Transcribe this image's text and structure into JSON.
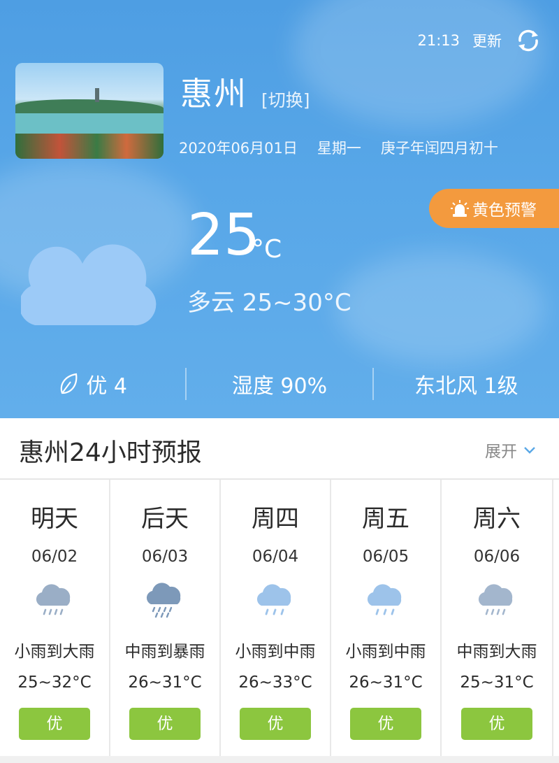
{
  "header": {
    "update_time": "21:13",
    "update_label": "更新",
    "city": "惠州",
    "switch_label": "[切换]",
    "date": "2020年06月01日",
    "weekday": "星期一",
    "lunar": "庚子年闰四月初十",
    "alert": "黄色预警"
  },
  "current": {
    "temp": "25",
    "unit": "°C",
    "condition": "多云 25~30°C",
    "icon": "partly-cloudy-night-icon"
  },
  "stats": {
    "aqi": "优 4",
    "humidity": "湿度 90%",
    "wind": "东北风 1级"
  },
  "forecast": {
    "title": "惠州24小时预报",
    "expand_label": "展开",
    "days": [
      {
        "name": "明天",
        "date": "06/02",
        "desc": "小雨到大雨",
        "temp": "25~32°C",
        "aqi": "优",
        "icon": "light-to-heavy-rain-icon"
      },
      {
        "name": "后天",
        "date": "06/03",
        "desc": "中雨到暴雨",
        "temp": "26~31°C",
        "aqi": "优",
        "icon": "moderate-to-torrential-rain-icon"
      },
      {
        "name": "周四",
        "date": "06/04",
        "desc": "小雨到中雨",
        "temp": "26~33°C",
        "aqi": "优",
        "icon": "light-to-moderate-rain-icon"
      },
      {
        "name": "周五",
        "date": "06/05",
        "desc": "小雨到中雨",
        "temp": "26~31°C",
        "aqi": "优",
        "icon": "light-to-moderate-rain-icon"
      },
      {
        "name": "周六",
        "date": "06/06",
        "desc": "中雨到大雨",
        "temp": "25~31°C",
        "aqi": "优",
        "icon": "moderate-to-heavy-rain-icon"
      }
    ]
  },
  "colors": {
    "hero_blue": "#58a7e8",
    "alert_orange": "#f39a3e",
    "aqi_green": "#8cc63f",
    "moon_yellow": "#f4c34d",
    "cloud_blue": "#9ccaf7"
  }
}
